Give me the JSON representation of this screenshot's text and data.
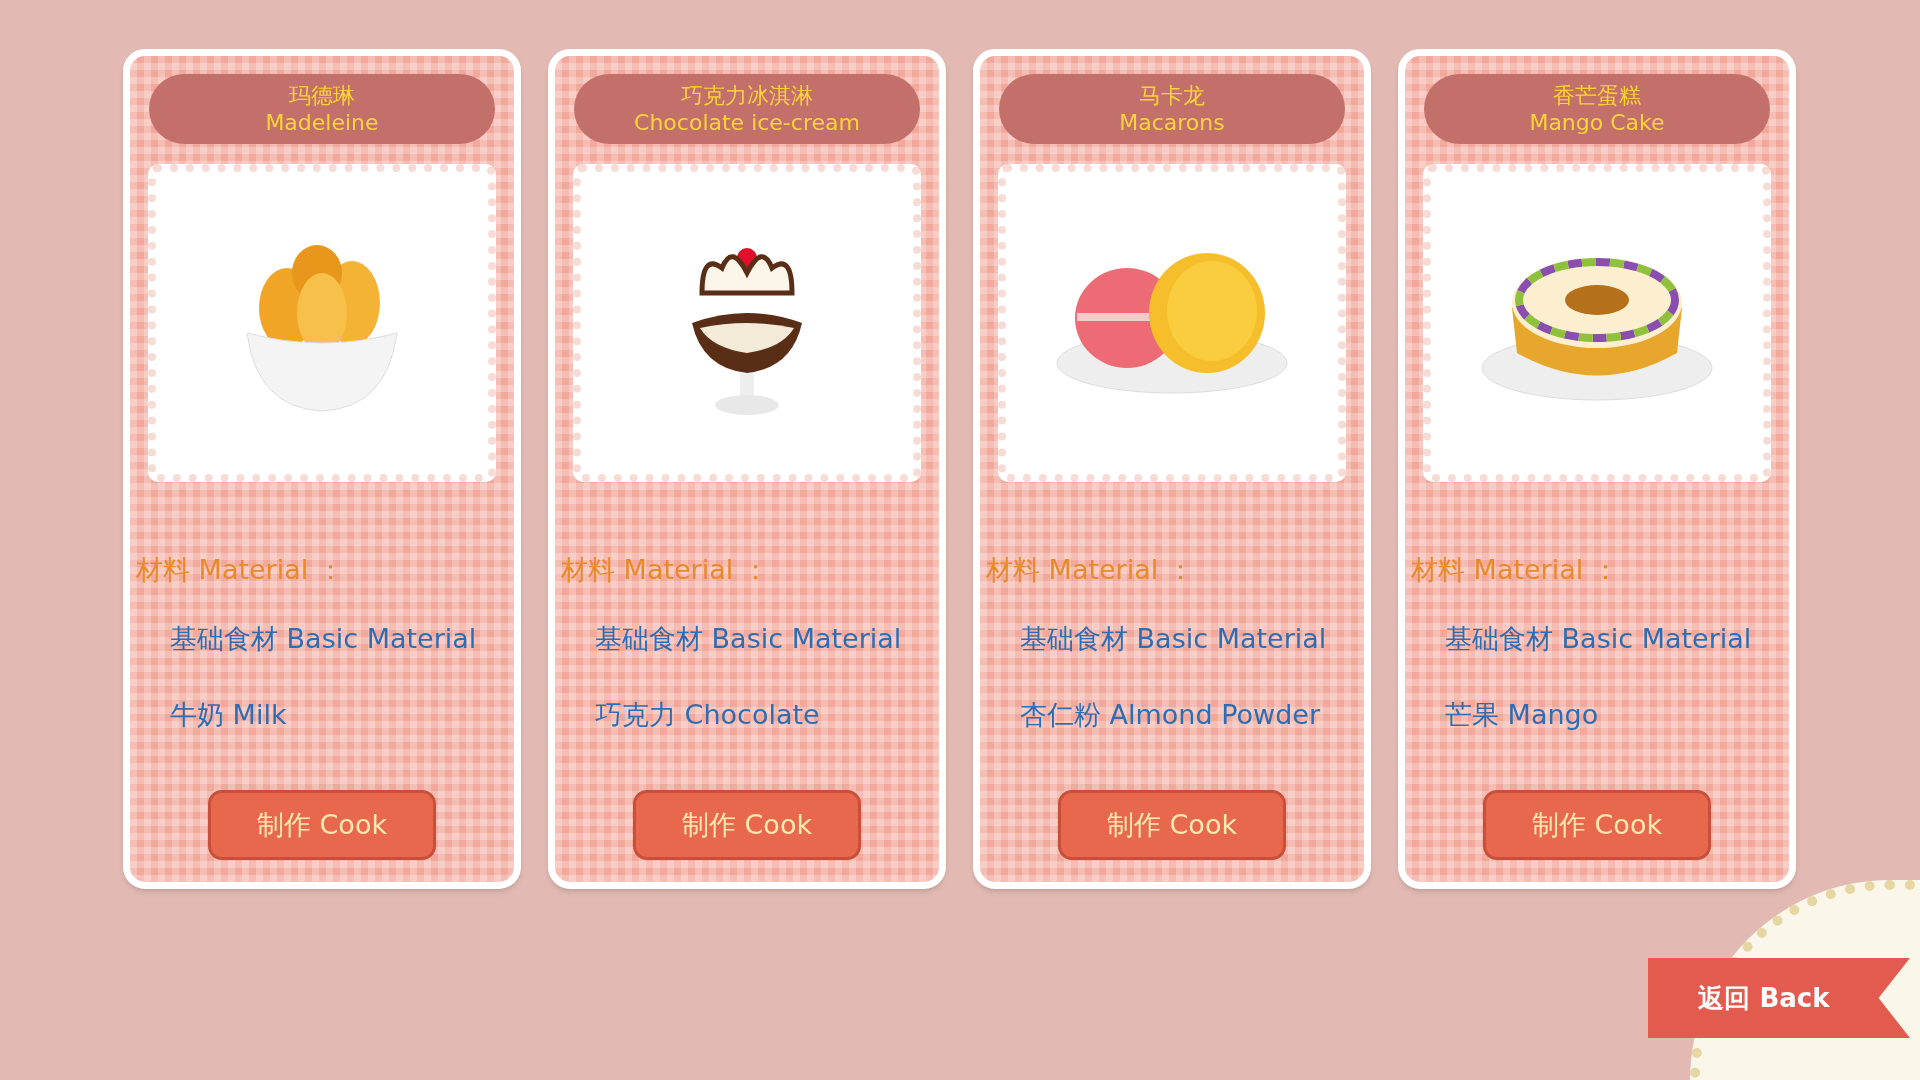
{
  "recipes": [
    {
      "kind": "madeleine",
      "title_zh": "玛德琳",
      "title_en": "Madeleine",
      "material_label": "材料 Material ：",
      "ingredients": [
        "基础食材 Basic Material",
        "牛奶 Milk"
      ],
      "button": "制作 Cook"
    },
    {
      "kind": "sundae",
      "title_zh": "巧克力冰淇淋",
      "title_en": "Chocolate ice-cream",
      "material_label": "材料 Material ：",
      "ingredients": [
        "基础食材 Basic Material",
        "巧克力 Chocolate"
      ],
      "button": "制作 Cook"
    },
    {
      "kind": "macaron",
      "title_zh": "马卡龙",
      "title_en": "Macarons",
      "material_label": "材料 Material ：",
      "ingredients": [
        "基础食材 Basic Material",
        "杏仁粉 Almond Powder"
      ],
      "button": "制作 Cook"
    },
    {
      "kind": "cake",
      "title_zh": "香芒蛋糕",
      "title_en": "Mango Cake",
      "material_label": "材料 Material ：",
      "ingredients": [
        "基础食材 Basic Material",
        "芒果 Mango"
      ],
      "button": "制作 Cook"
    }
  ],
  "back_button": "返回 Back"
}
